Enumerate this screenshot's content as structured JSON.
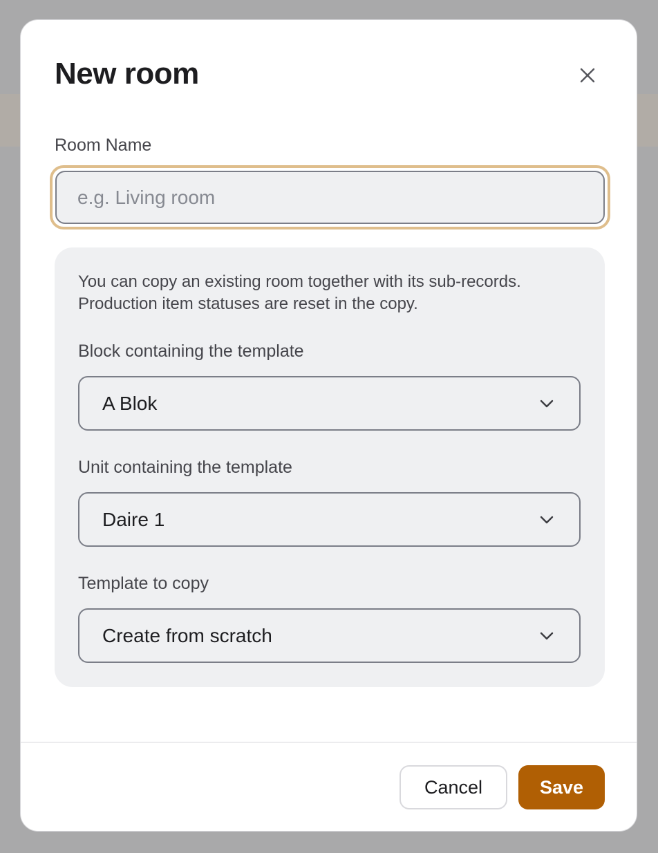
{
  "dialog": {
    "title": "New room",
    "close_icon": "close-icon"
  },
  "room_name": {
    "label": "Room Name",
    "placeholder": "e.g. Living room",
    "value": ""
  },
  "copy_panel": {
    "description_line1": "You can copy an existing room together with its sub-records.",
    "description_line2": "Production item statuses are reset in the copy.",
    "block": {
      "label": "Block containing the template",
      "selected": "A Blok"
    },
    "unit": {
      "label": "Unit containing the template",
      "selected": "Daire 1"
    },
    "template": {
      "label": "Template to copy",
      "selected": "Create from scratch"
    },
    "chevron_icon": "chevron-down-icon"
  },
  "footer": {
    "cancel_label": "Cancel",
    "save_label": "Save"
  },
  "colors": {
    "accent": "#b05f04",
    "focus_ring": "#dfbe8c",
    "panel_bg": "#eff0f2",
    "backdrop": "#a9a9aa"
  }
}
